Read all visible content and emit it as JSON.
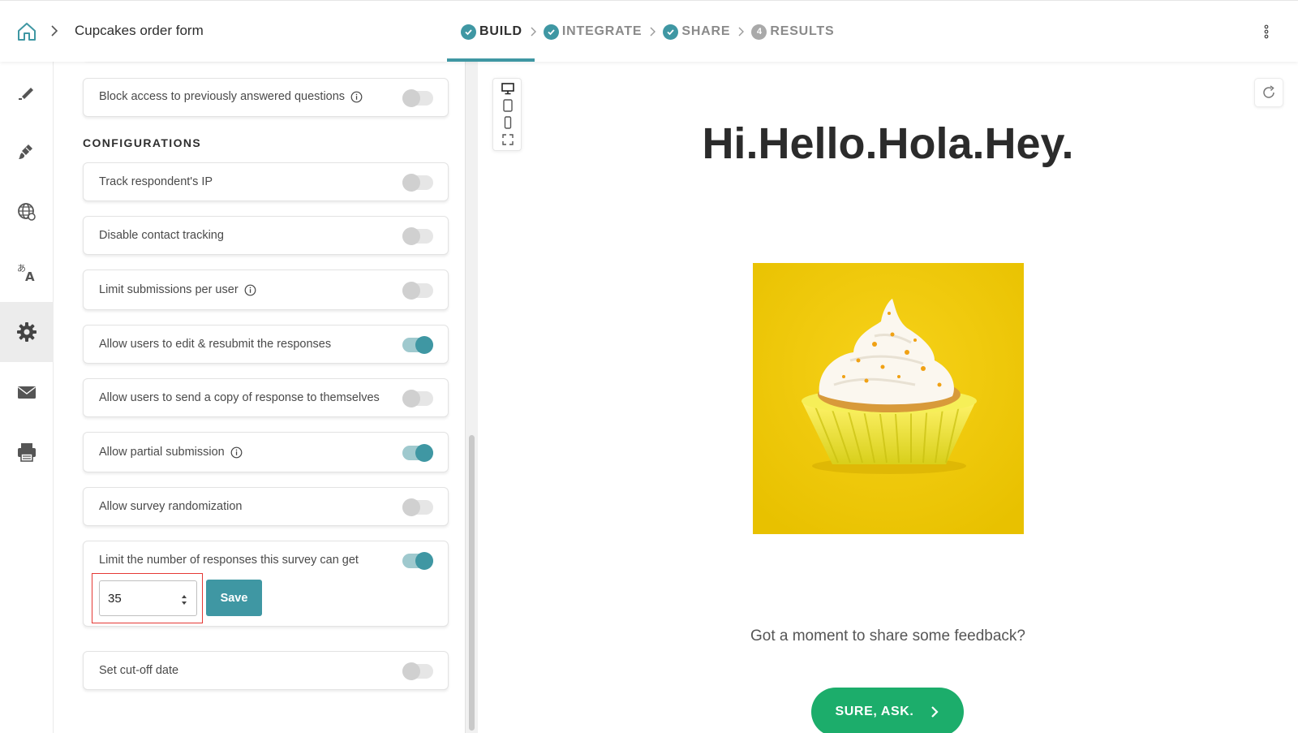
{
  "header": {
    "form_title": "Cupcakes order form",
    "steps": [
      {
        "label": "BUILD",
        "state": "done"
      },
      {
        "label": "INTEGRATE",
        "state": "done"
      },
      {
        "label": "SHARE",
        "state": "done"
      },
      {
        "label": "RESULTS",
        "number": "4"
      }
    ],
    "active_step": "BUILD"
  },
  "rail": {
    "icons": [
      "edit-icon",
      "paint-brush-icon",
      "globe-icon",
      "translate-icon",
      "settings-icon",
      "mail-icon",
      "print-icon"
    ],
    "active": "settings-icon"
  },
  "settings": {
    "section_title": "CONFIGURATIONS",
    "block_access": {
      "label": "Block access to previously answered questions",
      "enabled": false,
      "info": true
    },
    "items": [
      {
        "label": "Track respondent's IP",
        "enabled": false
      },
      {
        "label": "Disable contact tracking",
        "enabled": false
      },
      {
        "label": "Limit submissions per user",
        "enabled": false,
        "info": true
      },
      {
        "label": "Allow users to edit & resubmit the responses",
        "enabled": true
      },
      {
        "label": "Allow users to send a copy of response to themselves",
        "enabled": false
      },
      {
        "label": "Allow partial submission",
        "enabled": true,
        "info": true
      },
      {
        "label": "Allow survey randomization",
        "enabled": false
      }
    ],
    "limit_responses": {
      "label": "Limit the number of responses this survey can get",
      "enabled": true,
      "value": "35",
      "save_label": "Save"
    },
    "cutoff": {
      "label": "Set cut-off date",
      "enabled": false
    }
  },
  "preview": {
    "headline": "Hi.Hello.Hola.Hey.",
    "subtitle": "Got a moment to share some feedback?",
    "cta_label": "SURE, ASK.",
    "devices": [
      "desktop-icon",
      "tablet-icon",
      "phone-icon",
      "fullscreen-icon"
    ]
  },
  "colors": {
    "accent": "#3f97a3",
    "cta": "#1cad6b",
    "image_background": "#f1c400",
    "highlight": "#e53935"
  }
}
